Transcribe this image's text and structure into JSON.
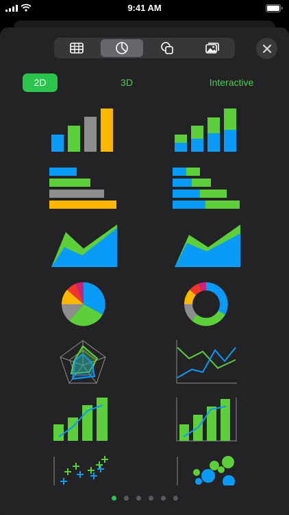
{
  "status_bar": {
    "time": "9:41 AM"
  },
  "toolbar": {
    "tabs": [
      {
        "icon": "table-icon",
        "selected": false
      },
      {
        "icon": "chart-icon",
        "selected": true
      },
      {
        "icon": "shapes-icon",
        "selected": false
      },
      {
        "icon": "media-icon",
        "selected": false
      }
    ],
    "close_icon": "close-icon"
  },
  "chart_types": {
    "tabs": [
      {
        "label": "2D",
        "selected": true
      },
      {
        "label": "3D",
        "selected": false
      },
      {
        "label": "Interactive",
        "selected": false
      }
    ]
  },
  "chart_icons": [
    "column-chart-icon",
    "stacked-column-chart-icon",
    "bar-chart-icon",
    "stacked-bar-chart-icon",
    "area-chart-icon",
    "stacked-area-chart-icon",
    "pie-chart-icon",
    "donut-chart-icon",
    "radar-chart-icon",
    "line-chart-icon",
    "mixed-chart-icon",
    "two-axis-chart-icon",
    "scatter-chart-icon",
    "bubble-chart-icon"
  ],
  "pagination": {
    "pages": 6,
    "current": 1
  },
  "colors": {
    "accent": "#2bc44d",
    "blue": "#0a9af8",
    "green": "#5ccf3a",
    "gray": "#8e8e8e",
    "yellow": "#fcb800",
    "red": "#f0382a",
    "magenta": "#d0217a",
    "sheet": "#232325"
  }
}
